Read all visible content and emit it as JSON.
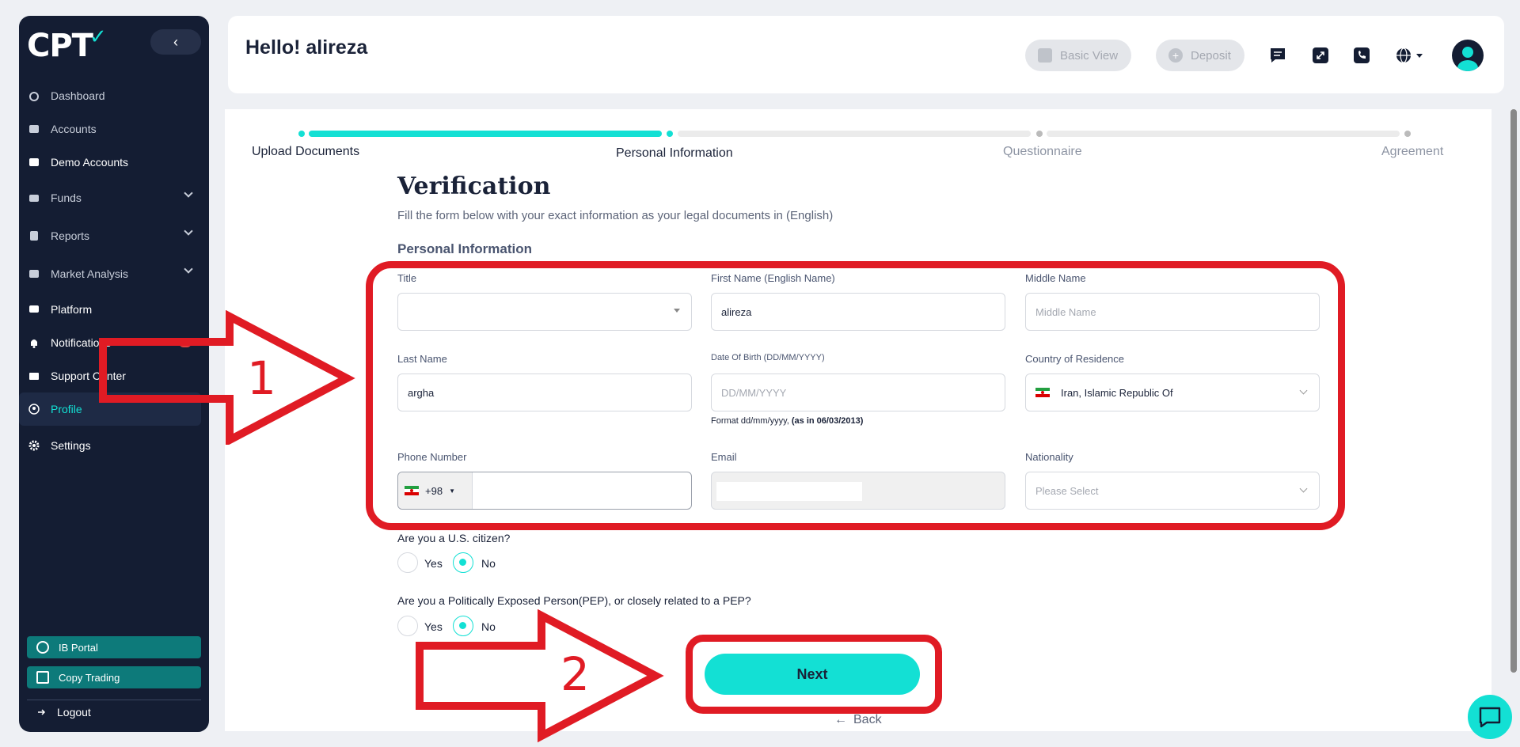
{
  "brand": {
    "logo_text": "CPT",
    "accent": "#13e0d4",
    "sidebar_bg": "#141d33",
    "annotation": "#e01b24"
  },
  "sidebar": {
    "items": [
      {
        "label": "Dashboard",
        "icon": "dashboard-icon"
      },
      {
        "label": "Accounts",
        "icon": "accounts-icon"
      },
      {
        "label": "Demo Accounts",
        "icon": "demo-accounts-icon"
      },
      {
        "label": "Funds",
        "icon": "wallet-icon"
      },
      {
        "label": "Reports",
        "icon": "reports-icon"
      },
      {
        "label": "Market Analysis",
        "icon": "market-analysis-icon"
      },
      {
        "label": "Platform",
        "icon": "platform-icon"
      },
      {
        "label": "Notifications",
        "icon": "bell-icon",
        "badge": "0"
      },
      {
        "label": "Support Center",
        "icon": "mail-icon"
      },
      {
        "label": "Profile",
        "icon": "user-circle-icon"
      },
      {
        "label": "Settings",
        "icon": "gear-icon"
      }
    ],
    "ib_portal": "IB Portal",
    "copy_trading": "Copy Trading",
    "logout": "Logout"
  },
  "header": {
    "greeting": "Hello! alireza",
    "basic_view": "Basic View",
    "deposit": "Deposit"
  },
  "steps": [
    {
      "label": "Upload Documents"
    },
    {
      "label": "Personal Information"
    },
    {
      "label": "Questionnaire"
    },
    {
      "label": "Agreement"
    }
  ],
  "form": {
    "title": "Verification",
    "subtitle": "Fill the form below with your exact information as your legal documents in (English)",
    "section": "Personal Information",
    "title_label": "Title",
    "first_name_label": "First Name (English Name)",
    "first_name_value": "alireza",
    "middle_name_label": "Middle Name",
    "middle_name_placeholder": "Middle Name",
    "last_name_label": "Last Name",
    "last_name_value": "argha",
    "dob_label": "Date Of Birth  (DD/MM/YYYY)",
    "dob_placeholder": "DD/MM/YYYY",
    "dob_hint": "Format dd/mm/yyyy,",
    "dob_hint_example": "(as in 06/03/2013)",
    "country_label": "Country of Residence",
    "country_value": "Iran, Islamic Republic Of",
    "phone_label": "Phone Number",
    "phone_code": "+98",
    "email_label": "Email",
    "nationality_label": "Nationality",
    "nationality_placeholder": "Please Select",
    "us_question": "Are you a U.S. citizen?",
    "pep_question": "Are you a Politically Exposed Person(PEP), or closely related to a PEP?",
    "yes": "Yes",
    "no": "No",
    "next": "Next",
    "back": "Back"
  },
  "annotations": {
    "one": "1",
    "two": "2"
  }
}
